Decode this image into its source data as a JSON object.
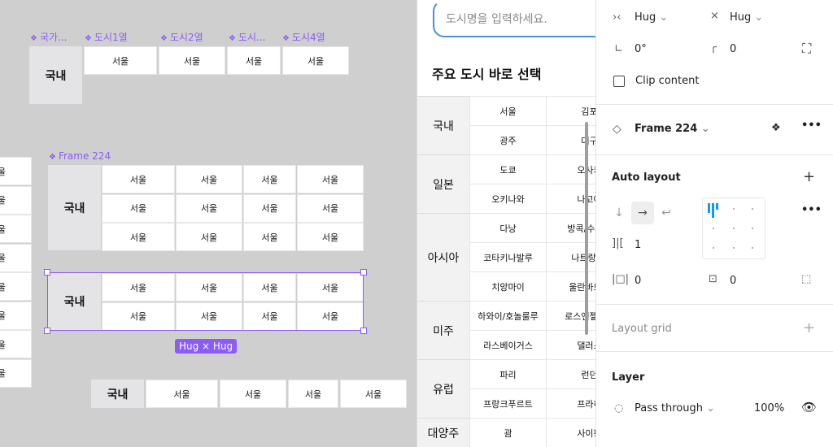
{
  "canvas": {
    "top_labels": [
      "국가...",
      "도시1열",
      "도시2열",
      "도시...",
      "도시4열"
    ],
    "top_header": "국내",
    "top_cities": [
      "서울",
      "서울",
      "서울",
      "서울"
    ],
    "frame_label": "Frame 224",
    "frame_header": "국내",
    "city": "서울",
    "selected_header": "국내",
    "hug_badge": "Hug × Hug",
    "bottom_header": "국내",
    "left_partial": "울",
    "diamond": "❖"
  },
  "preview": {
    "search_placeholder": "도시명을 입력하세요.",
    "title": "주요 도시 바로 선택",
    "regions": [
      {
        "name": "국내",
        "rows": [
          [
            "서울",
            "김포"
          ],
          [
            "광주",
            "대구"
          ]
        ]
      },
      {
        "name": "일본",
        "rows": [
          [
            "도쿄",
            "오사카"
          ],
          [
            "오키나와",
            "나고야"
          ]
        ]
      },
      {
        "name": "아시아",
        "rows": [
          [
            "다낭",
            "방콕/수완나"
          ],
          [
            "코타키나발루",
            "나트랑/칼"
          ],
          [
            "치앙마이",
            "울란바토르"
          ]
        ]
      },
      {
        "name": "미주",
        "rows": [
          [
            "하와이/호놀룰루",
            "로스앤젤레스"
          ],
          [
            "라스베이거스",
            "댈러스"
          ]
        ]
      },
      {
        "name": "유럽",
        "rows": [
          [
            "파리",
            "런던"
          ],
          [
            "프랑크푸르트",
            "프라하"
          ]
        ]
      },
      {
        "name": "대양주",
        "rows": [
          [
            "괌",
            "사이판"
          ]
        ]
      }
    ]
  },
  "panel": {
    "width_label": "Hug",
    "height_label": "Hug",
    "rotation": "0°",
    "radius": "0",
    "clip_content": "Clip content",
    "frame_name": "Frame 224",
    "auto_layout": "Auto layout",
    "gap": "1",
    "padding_h": "0",
    "padding_v": "0",
    "layout_grid": "Layout grid",
    "layer": "Layer",
    "blend_mode": "Pass through",
    "opacity": "100%"
  }
}
